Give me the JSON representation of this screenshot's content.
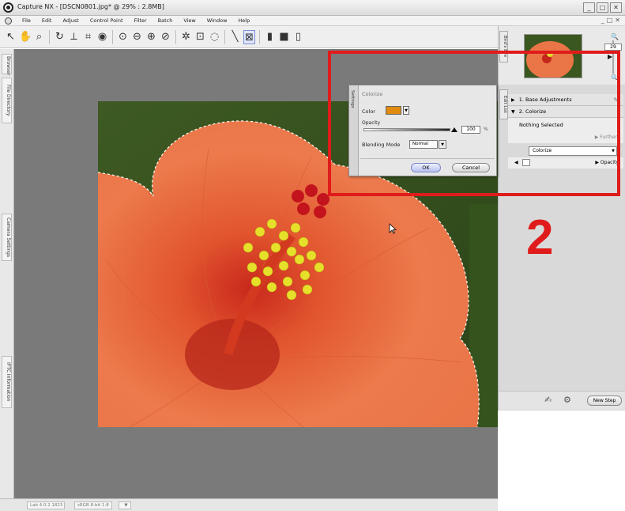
{
  "window": {
    "title": "Capture NX - [DSCN0801.jpg* @ 29% : 2.8MB]",
    "controls": [
      "_",
      "□",
      "✕"
    ]
  },
  "menu": {
    "items": [
      "File",
      "Edit",
      "Adjust",
      "Control Point",
      "Filter",
      "Batch",
      "View",
      "Window",
      "Help"
    ],
    "right_controls": [
      "_",
      "□",
      "✕"
    ]
  },
  "toolbar": {
    "tools": [
      "arrow-tool",
      "hand-tool",
      "zoom-tool",
      "rotate-tool",
      "straighten-tool",
      "crop-tool",
      "red-eye-tool",
      "color-control-point",
      "black-control-point",
      "white-control-point",
      "neutral-control-point",
      "selection-tool",
      "lasso-tool",
      "marquee-tool",
      "brush-tool",
      "fill-tool",
      "gradient-tool"
    ],
    "active_tool": "lasso-tool"
  },
  "left_tabs": [
    "Browser",
    "File Directory",
    "Camera Settings",
    "IPTC Information"
  ],
  "right_tabs": [
    "Bird's Eye",
    "Edit List"
  ],
  "birds_eye": {
    "zoom": "29"
  },
  "edit_list": {
    "steps": [
      {
        "number": "1.",
        "label": "Base Adjustments"
      },
      {
        "number": "2.",
        "label": "Colorize"
      }
    ],
    "nothing_selected": "Nothing Selected",
    "further": "Further",
    "dropdown_value": "Colorize",
    "opacity_label": "Opacity",
    "new_step_button": "New Step"
  },
  "colorize_dialog": {
    "title": "Colorize",
    "side_label": "Settings",
    "color_label": "Color",
    "color_value": "#e08a10",
    "opacity_label": "Opacity",
    "opacity_value": "100",
    "opacity_unit": "%",
    "blending_label": "Blending Mode",
    "blending_value": "Normal",
    "ok_label": "OK",
    "cancel_label": "Cancel"
  },
  "annotation": {
    "step_number": "2",
    "color": "#e01b1b"
  },
  "statusbar": {
    "fields": [
      "Lab 4.0.2.1823",
      "sRGB 8-bit 1:8"
    ]
  }
}
